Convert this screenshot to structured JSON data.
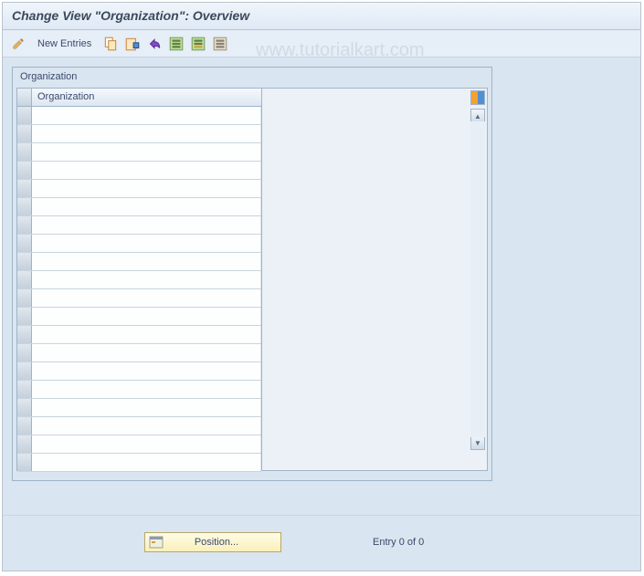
{
  "titlebar": {
    "title": "Change View \"Organization\": Overview"
  },
  "toolbar": {
    "new_entries_label": "New Entries",
    "icons": {
      "pencil": "pencil-icon",
      "copy": "copy-icon",
      "delete": "delete-icon",
      "undo": "undo-icon",
      "select_all": "select-all-icon",
      "deselect_all": "deselect-all-icon",
      "config": "config-icon"
    }
  },
  "watermark": {
    "text": "www.tutorialkart.com"
  },
  "panel": {
    "title": "Organization",
    "column_header": "Organization",
    "row_count": 20,
    "rows": [
      "",
      "",
      "",
      "",
      "",
      "",
      "",
      "",
      "",
      "",
      "",
      "",
      "",
      "",
      "",
      "",
      "",
      "",
      "",
      ""
    ]
  },
  "footer": {
    "position_label": "Position...",
    "entry_text": "Entry 0 of 0"
  },
  "colors": {
    "bg_light": "#d9e5f0",
    "border": "#9fb4c8",
    "text": "#3a4a6c"
  }
}
